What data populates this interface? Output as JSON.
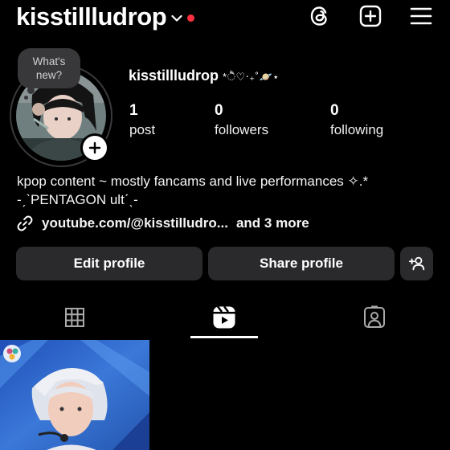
{
  "header": {
    "username": "kisstillludrop",
    "icons": [
      "chevron-down-icon",
      "threads-icon",
      "new-post-icon",
      "menu-icon"
    ],
    "notification_color": "#ff3040"
  },
  "profile": {
    "note_bubble": "What's new?",
    "display_name": "kisstillludrop",
    "display_name_deco": "*ੈ♡‧₊˚🪐⋆",
    "stats": [
      {
        "value": "1",
        "label": "post"
      },
      {
        "value": "0",
        "label": "followers"
      },
      {
        "value": "0",
        "label": "following"
      }
    ],
    "bio_line1": "kpop content ~ mostly fancams and live performances ✧.*",
    "bio_line2": "-ˏˋPENTAGON ultˊˎ-",
    "link_text": "youtube.com/@kisstilludro...",
    "link_more": "and 3 more"
  },
  "actions": {
    "edit_profile": "Edit profile",
    "share_profile": "Share profile"
  },
  "tabs": {
    "items": [
      "grid-icon",
      "reels-icon",
      "tagged-icon"
    ],
    "active": "reels-icon"
  },
  "grid": {
    "thumbnails": [
      "reel-thumbnail"
    ]
  },
  "colors": {
    "background": "#000000",
    "button_bg": "#2a2a2d",
    "accent_dot": "#ff3040"
  }
}
